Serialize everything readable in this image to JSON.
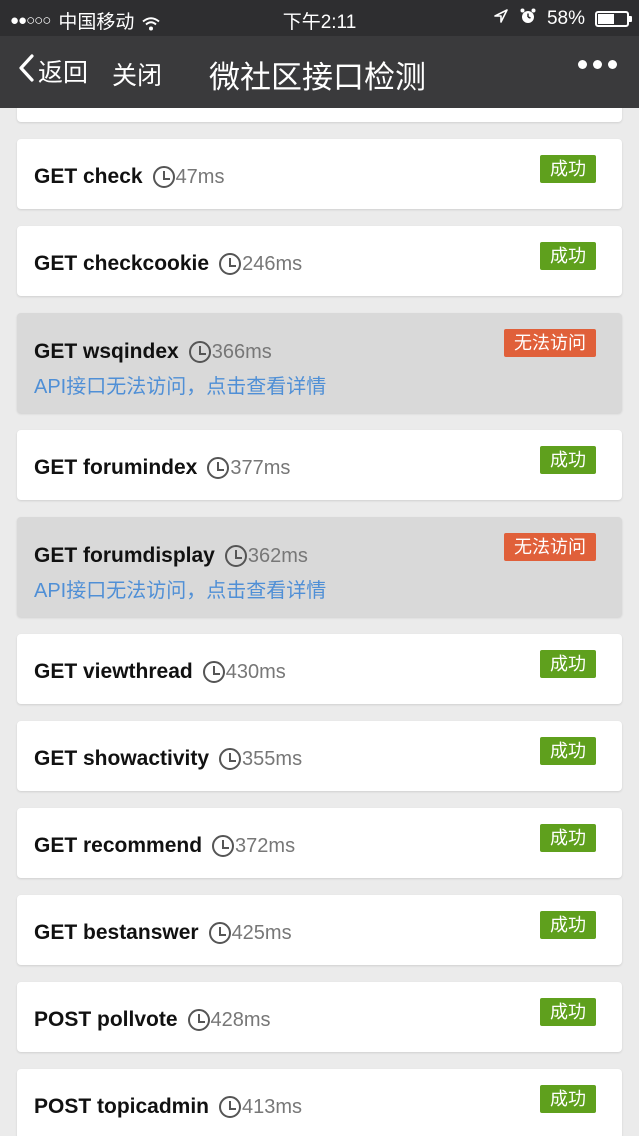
{
  "status_bar": {
    "signal": "●●○○○",
    "carrier": "中国移动",
    "time": "下午2:11",
    "battery": "58%",
    "battery_level": 0.58,
    "icons": [
      "wifi-icon",
      "location-arrow-icon",
      "alarm-icon",
      "battery-icon"
    ]
  },
  "nav": {
    "back_label": "返回",
    "close_label": "关闭",
    "title": "微社区接口检测",
    "icons": [
      "chevron-left-icon",
      "more-icon"
    ]
  },
  "colors": {
    "success": "#5fa01d",
    "failure": "#e0603a",
    "link": "#4f8fd6",
    "error_card_bg": "#d9d9d9"
  },
  "items": [
    {
      "name": "GET check",
      "time": "47ms",
      "status": "成功",
      "ok": true
    },
    {
      "name": "GET checkcookie",
      "time": "246ms",
      "status": "成功",
      "ok": true
    },
    {
      "name": "GET wsqindex",
      "time": "366ms",
      "status": "无法访问",
      "ok": false,
      "detail": "API接口无法访问，点击查看详情"
    },
    {
      "name": "GET forumindex",
      "time": "377ms",
      "status": "成功",
      "ok": true
    },
    {
      "name": "GET forumdisplay",
      "time": "362ms",
      "status": "无法访问",
      "ok": false,
      "detail": "API接口无法访问，点击查看详情"
    },
    {
      "name": "GET viewthread",
      "time": "430ms",
      "status": "成功",
      "ok": true
    },
    {
      "name": "GET showactivity",
      "time": "355ms",
      "status": "成功",
      "ok": true
    },
    {
      "name": "GET recommend",
      "time": "372ms",
      "status": "成功",
      "ok": true
    },
    {
      "name": "GET bestanswer",
      "time": "425ms",
      "status": "成功",
      "ok": true
    },
    {
      "name": "POST pollvote",
      "time": "428ms",
      "status": "成功",
      "ok": true
    },
    {
      "name": "POST topicadmin",
      "time": "413ms",
      "status": "成功",
      "ok": true
    }
  ]
}
